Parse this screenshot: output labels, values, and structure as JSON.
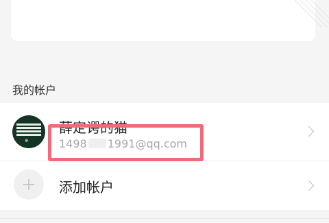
{
  "accounts_section": {
    "title": "我的帐户"
  },
  "current_account": {
    "name": "薛定谔的猫",
    "email_prefix": "1498",
    "email_suffix": "1991@qq.com",
    "avatar_icon": "striped-logo-avatar",
    "avatar_mark": "☸"
  },
  "add_account": {
    "label": "添加帐户",
    "icon": "plus-icon"
  },
  "colors": {
    "highlight_box": "#ef6b7a",
    "avatar_bg": "#143526",
    "background": "#f5f5f5"
  }
}
